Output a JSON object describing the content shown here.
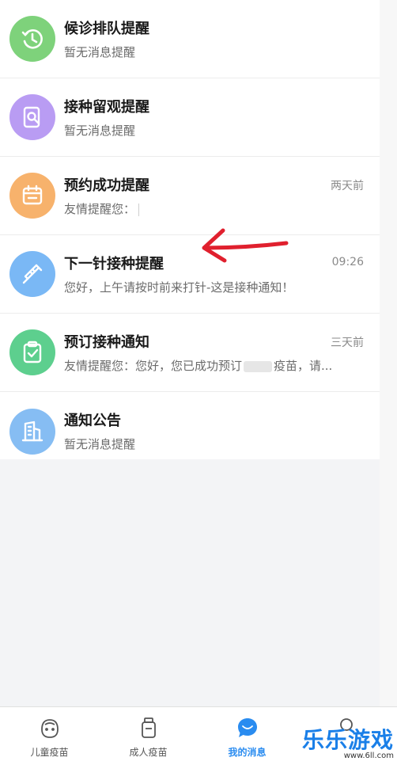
{
  "messages": [
    {
      "title": "候诊排队提醒",
      "subtitle": "暂无消息提醒",
      "time": "",
      "icon": "clock-history-icon",
      "color": "#7ed27b"
    },
    {
      "title": "接种留观提醒",
      "subtitle": "暂无消息提醒",
      "time": "",
      "icon": "document-search-icon",
      "color": "#b99cf3"
    },
    {
      "title": "预约成功提醒",
      "subtitle": "友情提醒您：",
      "time": "两天前",
      "icon": "calendar-icon",
      "color": "#f7b26c"
    },
    {
      "title": "下一针接种提醒",
      "subtitle": "您好，上午请按时前来打针-这是接种通知！",
      "time": "09:26",
      "icon": "syringe-icon",
      "color": "#7ab8f5"
    },
    {
      "title": "预订接种通知",
      "subtitle_a": "友情提醒您：您好，您已成功预订",
      "subtitle_b": "疫苗，请...",
      "time": "三天前",
      "icon": "clipboard-check-icon",
      "color": "#5dcf8e"
    },
    {
      "title": "通知公告",
      "subtitle": "暂无消息提醒",
      "time": "",
      "icon": "building-icon",
      "color": "#86bdf3"
    }
  ],
  "tabs": [
    {
      "label": "儿童疫苗",
      "icon": "child-face-icon",
      "active": false
    },
    {
      "label": "成人疫苗",
      "icon": "vaccine-bottle-icon",
      "active": false
    },
    {
      "label": "我的消息",
      "icon": "chat-bubble-icon",
      "active": true
    }
  ],
  "watermark": {
    "brand": "乐乐游戏",
    "url": "www.6ll.com"
  },
  "colors": {
    "accent": "#2a8cf0",
    "arrow": "#e0202e"
  }
}
